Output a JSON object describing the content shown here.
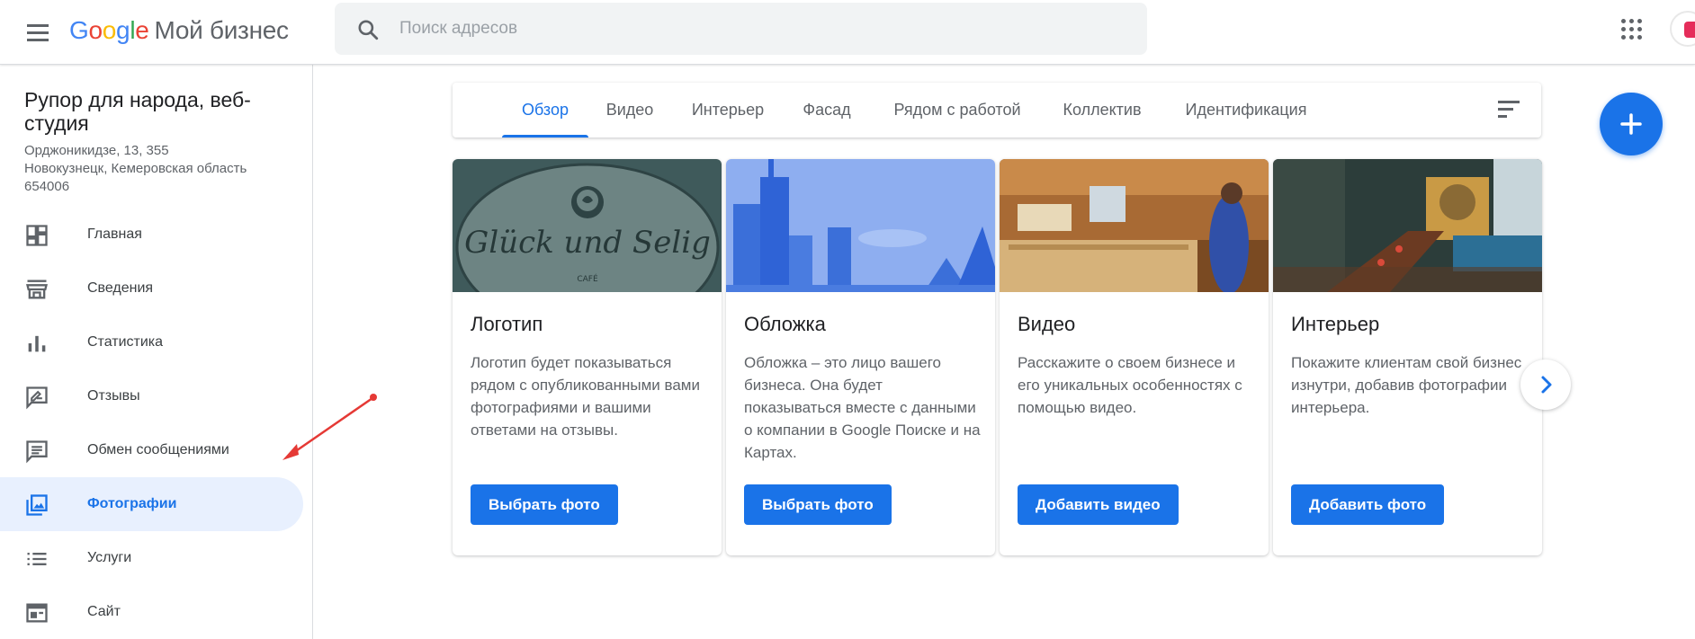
{
  "header": {
    "logo_letters": [
      "G",
      "o",
      "o",
      "g",
      "l",
      "e"
    ],
    "product_name": "Мой бизнес",
    "search_placeholder": "Поиск адресов",
    "icons": [
      "menu-icon",
      "search-icon",
      "apps-grid-icon",
      "account-avatar"
    ]
  },
  "business": {
    "name": "Рупор для народа, веб-студия",
    "address_line1": "Орджоникидзе, 13, 355",
    "address_line2": "Новокузнецк, Кемеровская область",
    "address_line3": "654006"
  },
  "sidebar": {
    "items": [
      {
        "label": "Главная",
        "icon": "dashboard-icon",
        "active": false
      },
      {
        "label": "Сведения",
        "icon": "store-icon",
        "active": false
      },
      {
        "label": "Статистика",
        "icon": "bar-chart-icon",
        "active": false
      },
      {
        "label": "Отзывы",
        "icon": "reviews-icon",
        "active": false
      },
      {
        "label": "Обмен сообщениями",
        "icon": "message-icon",
        "active": false
      },
      {
        "label": "Фотографии",
        "icon": "photo-library-icon",
        "active": true
      },
      {
        "label": "Услуги",
        "icon": "list-icon",
        "active": false
      },
      {
        "label": "Сайт",
        "icon": "web-icon",
        "active": false
      }
    ]
  },
  "tabs": [
    {
      "label": "Обзор",
      "active": true
    },
    {
      "label": "Видео",
      "active": false
    },
    {
      "label": "Интерьер",
      "active": false
    },
    {
      "label": "Фасад",
      "active": false
    },
    {
      "label": "Рядом с работой",
      "active": false
    },
    {
      "label": "Коллектив",
      "active": false
    },
    {
      "label": "Идентификация",
      "active": false
    }
  ],
  "cards": [
    {
      "title": "Логотип",
      "description": "Логотип будет показываться рядом с опубликованными вами фотографиями и вашими ответами на отзывы.",
      "button": "Выбрать фото",
      "image_text": "Glück und Selig",
      "image_subtext": "CAFÉ"
    },
    {
      "title": "Обложка",
      "description": "Обложка – это лицо вашего бизнеса. Она будет показываться вместе с данными о компании в Google Поиске и на Картах.",
      "button": "Выбрать фото"
    },
    {
      "title": "Видео",
      "description": "Расскажите о своем бизнесе и его уникальных особенностях с помощью видео.",
      "button": "Добавить видео"
    },
    {
      "title": "Интерьер",
      "description": "Покажите клиентам свой бизнес изнутри, добавив фотографии интерьера.",
      "button": "Добавить фото"
    }
  ],
  "colors": {
    "accent": "#1a73e8",
    "active_bg": "#e8f0fe",
    "annotation_arrow": "#e53935"
  }
}
